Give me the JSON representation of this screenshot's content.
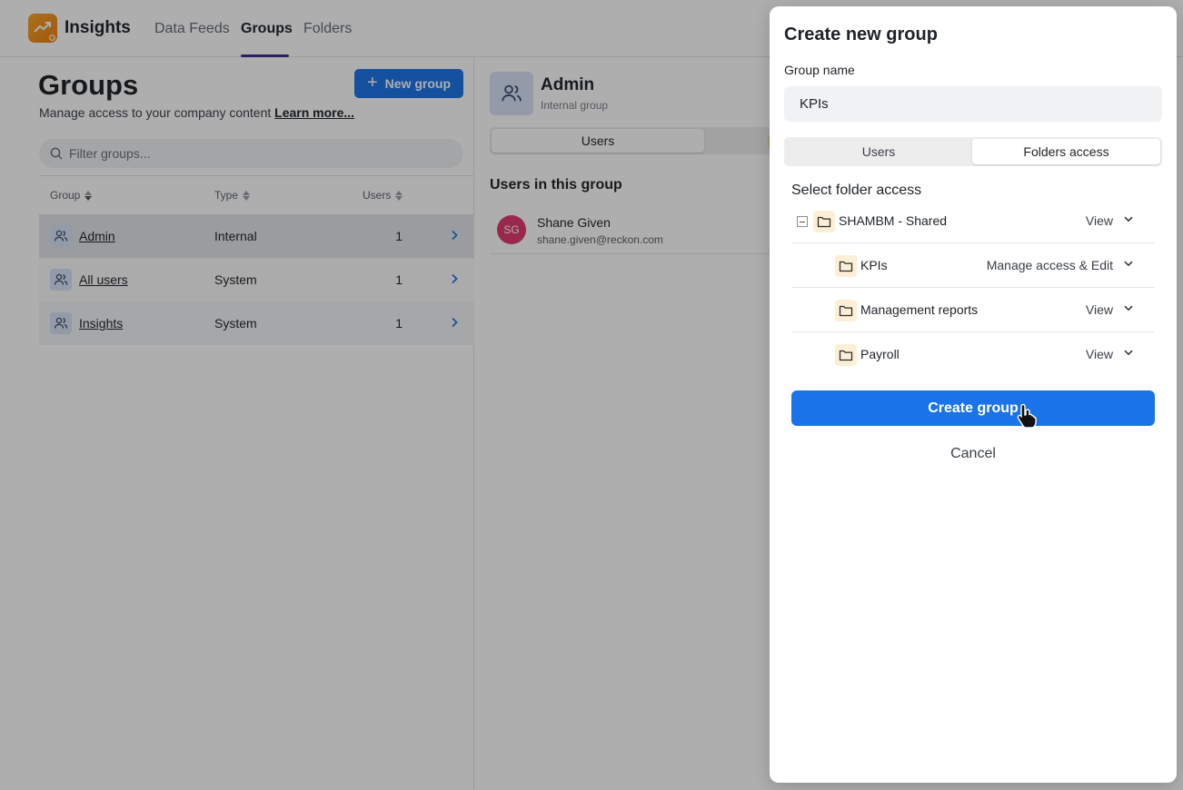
{
  "app": {
    "name": "Insights",
    "accent": "#1a73e8",
    "logo_color": "#f6a623"
  },
  "nav": {
    "tabs": [
      {
        "label": "Data Feeds",
        "active": false
      },
      {
        "label": "Groups",
        "active": true
      },
      {
        "label": "Folders",
        "active": false
      }
    ]
  },
  "groups_page": {
    "title": "Groups",
    "subtitle": "Manage access to your company content",
    "learn_more": "Learn more...",
    "new_group_label": "New group",
    "filter_placeholder": "Filter groups...",
    "columns": {
      "group": "Group",
      "type": "Type",
      "users": "Users"
    },
    "rows": [
      {
        "name": "Admin",
        "type": "Internal",
        "users": "1",
        "selected": true
      },
      {
        "name": "All users",
        "type": "System",
        "users": "1",
        "selected": false
      },
      {
        "name": "Insights",
        "type": "System",
        "users": "1",
        "selected": false
      }
    ]
  },
  "detail": {
    "title": "Admin",
    "subtitle": "Internal group",
    "tab_users": "Users",
    "users_heading": "Users in this group",
    "users": [
      {
        "initials": "SG",
        "name": "Shane Given",
        "email": "shane.given@reckon.com",
        "color": "#e0396e"
      }
    ]
  },
  "modal": {
    "title": "Create new group",
    "group_name_label": "Group name",
    "group_name_value": "KPIs",
    "tabs": {
      "users": "Users",
      "folders_access": "Folders access"
    },
    "active_tab": "folders_access",
    "select_heading": "Select folder access",
    "folders": [
      {
        "name": "SHAMBM - Shared",
        "access": "View",
        "level": 0
      },
      {
        "name": "KPIs",
        "access": "Manage access & Edit",
        "level": 1
      },
      {
        "name": "Management reports",
        "access": "View",
        "level": 1
      },
      {
        "name": "Payroll",
        "access": "View",
        "level": 1
      }
    ],
    "create_label": "Create group",
    "cancel_label": "Cancel"
  }
}
